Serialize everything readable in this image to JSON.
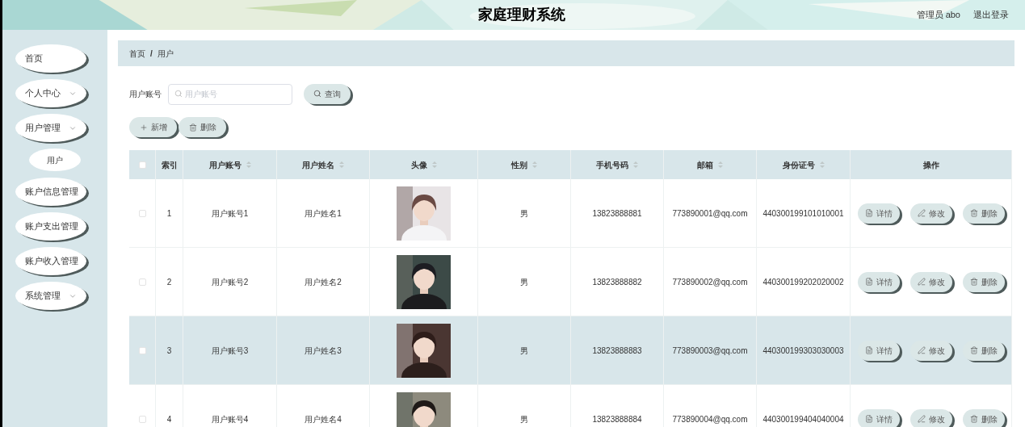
{
  "header": {
    "title": "家庭理财系统",
    "user": "管理员 abo",
    "logout": "退出登录"
  },
  "sidebar": {
    "items": [
      {
        "label": "首页",
        "expandable": false,
        "selected": false
      },
      {
        "label": "个人中心",
        "expandable": true,
        "selected": false
      },
      {
        "label": "用户管理",
        "expandable": true,
        "selected": false,
        "children": [
          {
            "label": "用户",
            "selected": true
          }
        ]
      },
      {
        "label": "账户信息管理",
        "expandable": false,
        "selected": false
      },
      {
        "label": "账户支出管理",
        "expandable": false,
        "selected": false
      },
      {
        "label": "账户收入管理",
        "expandable": false,
        "selected": false
      },
      {
        "label": "系统管理",
        "expandable": true,
        "selected": false
      }
    ]
  },
  "breadcrumb": [
    "首页",
    "/",
    "用户"
  ],
  "search": {
    "label": "用户账号",
    "placeholder": "用户账号",
    "button": "查询"
  },
  "toolbar": [
    {
      "kind": "add",
      "label": "新增"
    },
    {
      "kind": "delete",
      "label": "删除"
    }
  ],
  "table": {
    "all_checked": false,
    "columns": [
      {
        "label": "索引",
        "sortable": false
      },
      {
        "label": "用户账号",
        "sortable": true
      },
      {
        "label": "用户姓名",
        "sortable": true
      },
      {
        "label": "头像",
        "sortable": true
      },
      {
        "label": "性别",
        "sortable": true
      },
      {
        "label": "手机号码",
        "sortable": true
      },
      {
        "label": "邮箱",
        "sortable": true
      },
      {
        "label": "身份证号",
        "sortable": true
      },
      {
        "label": "操作",
        "sortable": false
      }
    ],
    "rows": [
      {
        "index": "1",
        "account": "用户账号1",
        "name": "用户姓名1",
        "avatar": {
          "kind": "picture"
        },
        "gender": "男",
        "phone": "13823888881",
        "email": "773890001@qq.com",
        "id_number": "440300199101010001",
        "checked": false,
        "highlighted": false,
        "actions": [
          {
            "kind": "detail",
            "label": "详情"
          },
          {
            "kind": "edit",
            "label": "修改"
          },
          {
            "kind": "delete",
            "label": "删除"
          }
        ]
      },
      {
        "index": "2",
        "account": "用户账号2",
        "name": "用户姓名2",
        "avatar": {
          "kind": "picture"
        },
        "gender": "男",
        "phone": "13823888882",
        "email": "773890002@qq.com",
        "id_number": "440300199202020002",
        "checked": false,
        "highlighted": false,
        "actions": [
          {
            "kind": "detail",
            "label": "详情"
          },
          {
            "kind": "edit",
            "label": "修改"
          },
          {
            "kind": "delete",
            "label": "删除"
          }
        ]
      },
      {
        "index": "3",
        "account": "用户账号3",
        "name": "用户姓名3",
        "avatar": {
          "kind": "picture"
        },
        "gender": "男",
        "phone": "13823888883",
        "email": "773890003@qq.com",
        "id_number": "440300199303030003",
        "checked": false,
        "highlighted": true,
        "actions": [
          {
            "kind": "detail",
            "label": "详情"
          },
          {
            "kind": "edit",
            "label": "修改"
          },
          {
            "kind": "delete",
            "label": "删除"
          }
        ]
      },
      {
        "index": "4",
        "account": "用户账号4",
        "name": "用户姓名4",
        "avatar": {
          "kind": "picture"
        },
        "gender": "男",
        "phone": "13823888884",
        "email": "773890004@qq.com",
        "id_number": "440300199404040004",
        "checked": false,
        "highlighted": false,
        "actions": [
          {
            "kind": "detail",
            "label": "详情"
          },
          {
            "kind": "edit",
            "label": "修改"
          },
          {
            "kind": "delete",
            "label": "删除"
          }
        ]
      }
    ]
  }
}
